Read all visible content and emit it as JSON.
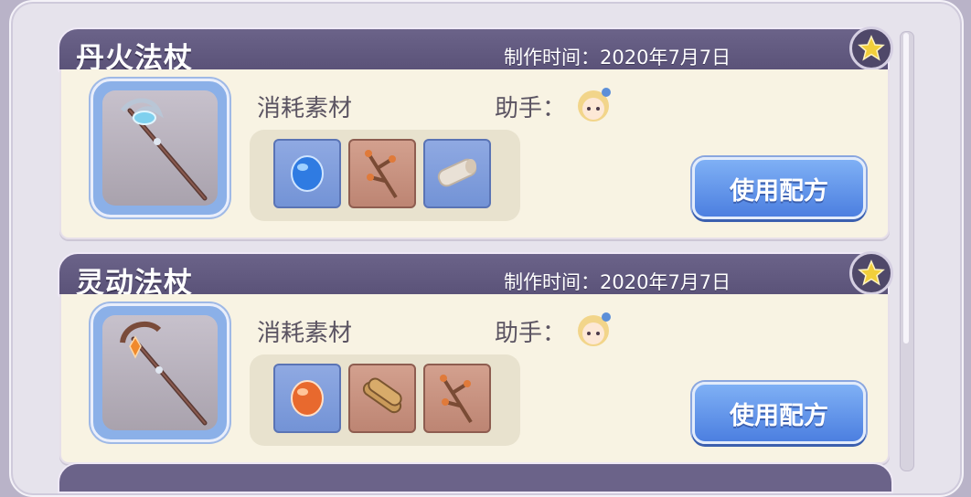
{
  "recipes": [
    {
      "title": "丹火法杖",
      "time": "制作时间：2020年7月7日",
      "materials_label": "消耗素材",
      "assistant_label": "助手：",
      "button": "使用配方",
      "item_icon": "staff-blue-crescent",
      "materials": [
        "blue-gem-icon",
        "branch-icon",
        "log-icon"
      ]
    },
    {
      "title": "灵动法杖",
      "time": "制作时间：2020年7月7日",
      "materials_label": "消耗素材",
      "assistant_label": "助手：",
      "button": "使用配方",
      "item_icon": "staff-orange-crystal",
      "materials": [
        "orange-gem-icon",
        "wood-bundle-icon",
        "branch-icon"
      ]
    }
  ],
  "colors": {
    "header": "#5a5278",
    "body": "#f8f3e3",
    "button": "#4c7fe0",
    "star": "#f2cf3b"
  }
}
